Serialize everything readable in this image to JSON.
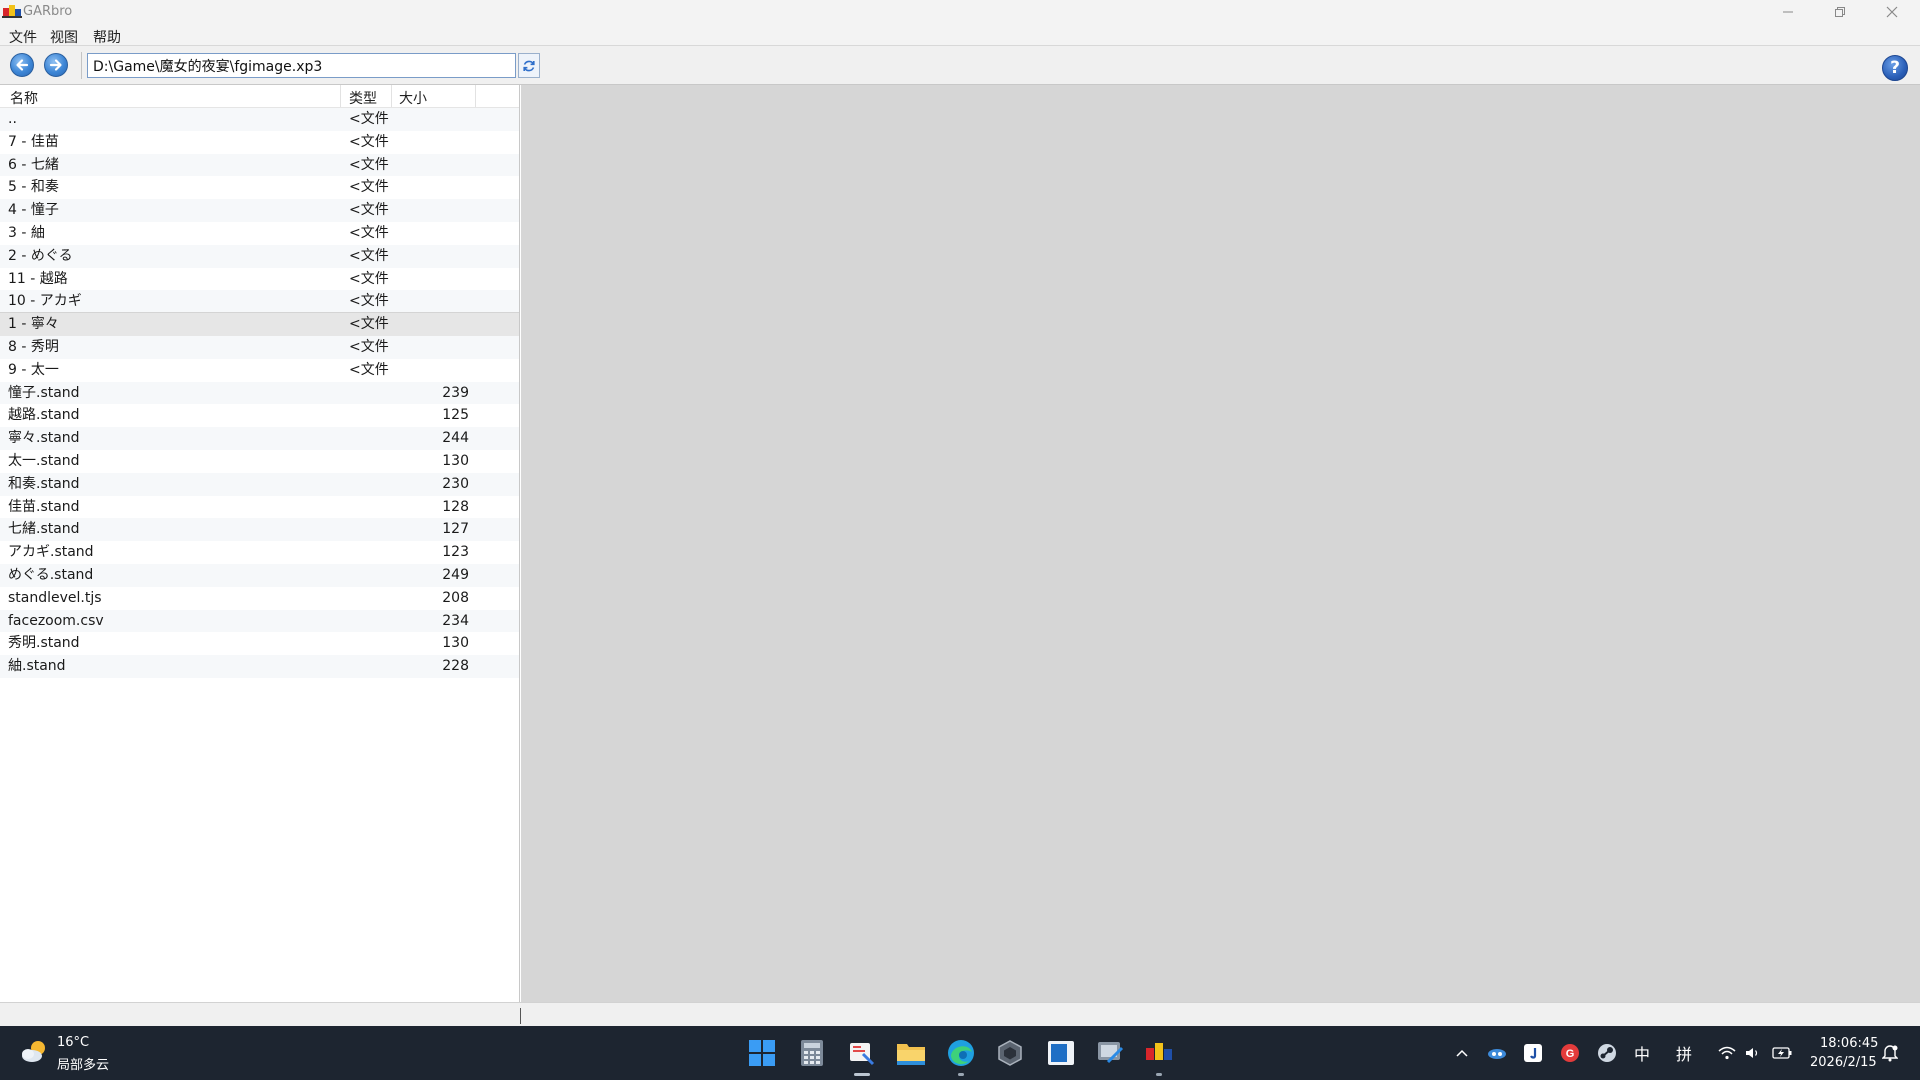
{
  "window": {
    "title": "GARbro"
  },
  "menu": [
    "文件",
    "视图",
    "帮助"
  ],
  "toolbar": {
    "path": "D:\\Game\\魔女的夜宴\\fgimage.xp3",
    "help_label": "?"
  },
  "list": {
    "columns": {
      "name": "名称",
      "type": "类型",
      "size": "大小"
    },
    "rows": [
      {
        "name": "..",
        "type": "<文件",
        "size": ""
      },
      {
        "name": "7 - 佳苗",
        "type": "<文件",
        "size": ""
      },
      {
        "name": "6 - 七緒",
        "type": "<文件",
        "size": ""
      },
      {
        "name": "5 - 和奏",
        "type": "<文件",
        "size": ""
      },
      {
        "name": "4 - 憧子",
        "type": "<文件",
        "size": ""
      },
      {
        "name": "3 - 紬",
        "type": "<文件",
        "size": ""
      },
      {
        "name": "2 - めぐる",
        "type": "<文件",
        "size": ""
      },
      {
        "name": "11 - 越路",
        "type": "<文件",
        "size": ""
      },
      {
        "name": "10 - アカギ",
        "type": "<文件",
        "size": ""
      },
      {
        "name": "1 - 寧々",
        "type": "<文件",
        "size": ""
      },
      {
        "name": "8 - 秀明",
        "type": "<文件",
        "size": ""
      },
      {
        "name": "9 - 太一",
        "type": "<文件",
        "size": ""
      },
      {
        "name": "憧子.stand",
        "type": "",
        "size": "239"
      },
      {
        "name": "越路.stand",
        "type": "",
        "size": "125"
      },
      {
        "name": "寧々.stand",
        "type": "",
        "size": "244"
      },
      {
        "name": "太一.stand",
        "type": "",
        "size": "130"
      },
      {
        "name": "和奏.stand",
        "type": "",
        "size": "230"
      },
      {
        "name": "佳苗.stand",
        "type": "",
        "size": "128"
      },
      {
        "name": "七緒.stand",
        "type": "",
        "size": "127"
      },
      {
        "name": "アカギ.stand",
        "type": "",
        "size": "123"
      },
      {
        "name": "めぐる.stand",
        "type": "",
        "size": "249"
      },
      {
        "name": "standlevel.tjs",
        "type": "",
        "size": "208"
      },
      {
        "name": "facezoom.csv",
        "type": "",
        "size": "234"
      },
      {
        "name": "秀明.stand",
        "type": "",
        "size": "130"
      },
      {
        "name": "紬.stand",
        "type": "",
        "size": "228"
      }
    ],
    "selected_index": 9
  },
  "taskbar": {
    "weather": {
      "temp": "16°C",
      "desc": "局部多云"
    },
    "ime_lang": "中",
    "ime_mode": "拼",
    "time": "18:06:45",
    "date": "2026/2/15"
  },
  "colors": {
    "preview_bg": "#d6d6d6",
    "taskbar_bg": "#1d2530",
    "accent": "#2f6fca"
  }
}
